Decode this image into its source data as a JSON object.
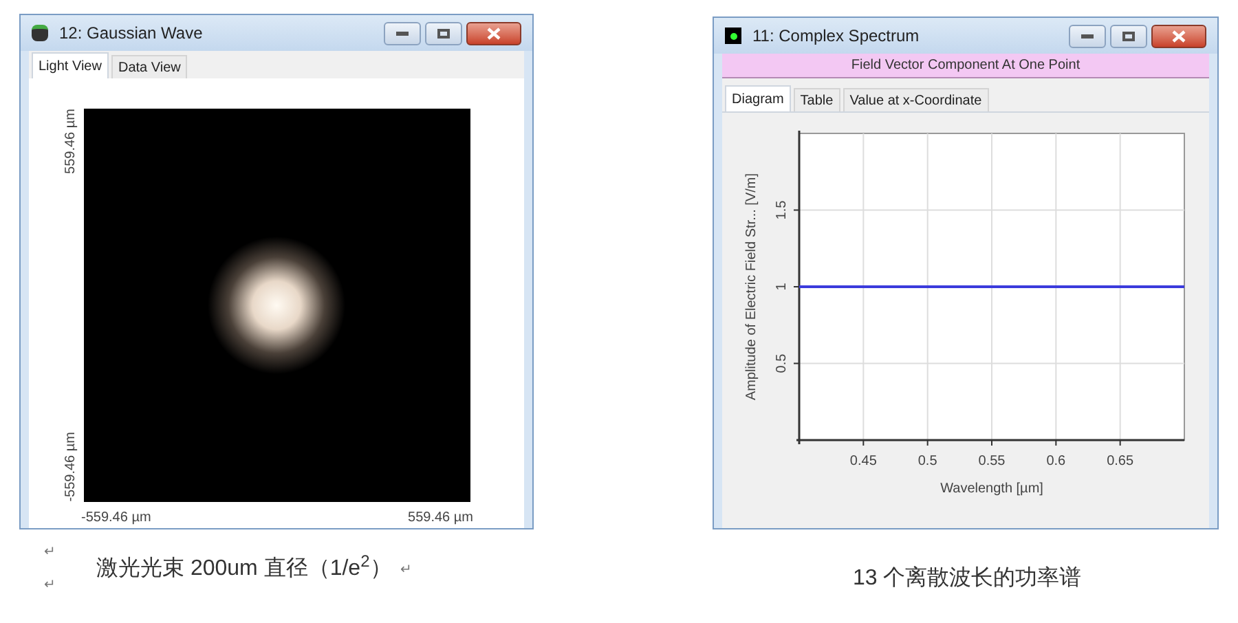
{
  "windows": [
    {
      "kind": "light_view",
      "title": "12: Gaussian Wave",
      "tabs": [
        {
          "label": "Light View",
          "selected": true
        },
        {
          "label": "Data View",
          "selected": false
        }
      ],
      "axis_labels": {
        "y_top": "559.46 µm",
        "y_bottom": "-559.46 µm",
        "x_left": "-559.46 µm",
        "x_right": "559.46 µm"
      }
    },
    {
      "kind": "diagram",
      "title": "11: Complex Spectrum",
      "header": "Field Vector Component At One Point",
      "tabs": [
        {
          "label": "Diagram",
          "selected": true
        },
        {
          "label": "Table",
          "selected": false
        },
        {
          "label": "Value at x-Coordinate",
          "selected": false
        }
      ],
      "chart_data": {
        "type": "line",
        "xlabel": "Wavelength [µm]",
        "ylabel": "Amplitude of Electric Field Str... [V/m]",
        "x": [
          0.4,
          0.7
        ],
        "grid": true,
        "series": [
          {
            "color": "#3b3bdc",
            "values": [
              1,
              1
            ]
          }
        ],
        "xlim": [
          0.4,
          0.7
        ],
        "ylim": [
          0,
          2
        ],
        "xticks": [
          0.45,
          0.5,
          0.55,
          0.6,
          0.65
        ],
        "yticks": [
          0.5,
          1,
          1.5
        ]
      }
    }
  ],
  "captions": [
    {
      "text": "激光光束 200um 直径（1/e$^{2}$）",
      "end_mark": "↵",
      "margin_marks": [
        "↵",
        "↵"
      ]
    },
    {
      "text": "13 个离散波长的功率谱"
    }
  ]
}
